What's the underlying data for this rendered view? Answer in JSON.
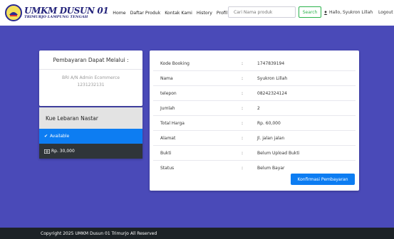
{
  "brand": {
    "title": "UMKM DUSUN 01",
    "subtitle": "TRIMURJO LAMPUNG TENGAH"
  },
  "nav": {
    "links": [
      "Home",
      "Daftar Produk",
      "Kontak Kami",
      "History",
      "Profil"
    ]
  },
  "search": {
    "placeholder": "Cari Nama produk",
    "button_label": "Search"
  },
  "user": {
    "greeting": "Hallo, Syukron Lillah",
    "logout_label": "Logout"
  },
  "payment": {
    "title": "Pembayaran Dapat Melalui :",
    "bank": "BRI A/N Admin Ecommerce",
    "account_number": "1231232131"
  },
  "product": {
    "name": "Kue Lebaran Nastar",
    "status": "Available",
    "price": "Rp. 30,000"
  },
  "booking": {
    "rows": [
      {
        "label": "Kode Booking",
        "value": "1747839194"
      },
      {
        "label": "Nama",
        "value": "Syukron Lillah"
      },
      {
        "label": "telepon",
        "value": "08242324124"
      },
      {
        "label": "Jumlah",
        "value": "2"
      },
      {
        "label": "Total Harga",
        "value": "Rp. 60,000"
      },
      {
        "label": "Alamat",
        "value": "Jl. jalan jalan"
      },
      {
        "label": "Bukti",
        "value": "Belum Upload Bukti"
      },
      {
        "label": "Status",
        "value": "Belum Bayar"
      }
    ],
    "separator": ":",
    "confirm_label": "Konfirmasi Pembayaran"
  },
  "footer": {
    "copyright": "Copyright 2025 UMKM Dusun 01 Trimurjo All Reserved"
  },
  "colors": {
    "page_background": "#4a4ab8",
    "primary": "#0d7df2",
    "search_green": "#2bb24c",
    "footer": "#1c2226"
  }
}
